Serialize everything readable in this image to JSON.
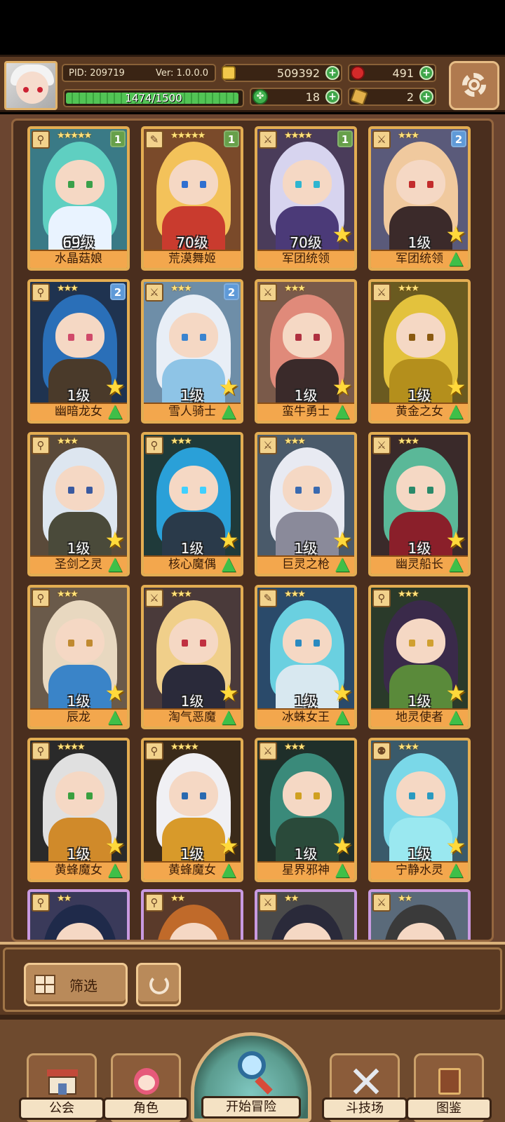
{
  "header": {
    "pid": "PID: 209719",
    "version": "Ver: 1.0.0.0",
    "gold": "509392",
    "gems": "491",
    "clover": "18",
    "keys": "2",
    "exp_text": "1474/1500",
    "exp_fraction": 0.983
  },
  "cards": [
    {
      "name": "水晶菇娘",
      "level": "69级",
      "stars": "★★★★★",
      "badge": "1",
      "badge_color": "green",
      "border": "gold",
      "hair": "#5fcfc1",
      "body": "#e9f3ff",
      "eye": "#3aa04a",
      "bg": "#3a7a86",
      "type_icon": "⚲",
      "show_upgrade": false
    },
    {
      "name": "荒漠舞姬",
      "level": "70级",
      "stars": "★★★★★",
      "badge": "1",
      "badge_color": "green",
      "border": "gold",
      "hair": "#f3c25a",
      "body": "#c93b2e",
      "eye": "#2f6fd0",
      "bg": "#7a4a2a",
      "type_icon": "✎",
      "show_upgrade": false
    },
    {
      "name": "军团统领",
      "level": "70级",
      "stars": "★★★★",
      "badge": "1",
      "badge_color": "green",
      "border": "gold",
      "hair": "#d7d4ef",
      "body": "#4b3a78",
      "eye": "#2fb5d0",
      "bg": "#4a3c5a",
      "type_icon": "⚔",
      "show_upgrade": false,
      "star_only": true
    },
    {
      "name": "军团统领",
      "level": "1级",
      "stars": "★★★",
      "badge": "2",
      "badge_color": "blue",
      "border": "gold",
      "hair": "#f0c99e",
      "body": "#3b2a2a",
      "eye": "#c32c2c",
      "bg": "#5a5a7a",
      "type_icon": "⚔",
      "show_upgrade": true
    },
    {
      "name": "幽暗龙女",
      "level": "1级",
      "stars": "★★★",
      "badge": "2",
      "badge_color": "blue",
      "border": "gold",
      "hair": "#2a6fb8",
      "body": "#4a3a2a",
      "eye": "#d04a6a",
      "bg": "#1f3350",
      "type_icon": "⚲",
      "show_upgrade": true
    },
    {
      "name": "雪人骑士",
      "level": "1级",
      "stars": "★★★",
      "badge": "2",
      "badge_color": "blue",
      "border": "gold",
      "hair": "#e8eef6",
      "body": "#8ec4e6",
      "eye": "#3a84d0",
      "bg": "#6e8ea8",
      "type_icon": "⚔",
      "show_upgrade": true
    },
    {
      "name": "蛮牛勇士",
      "level": "1级",
      "stars": "★★★",
      "badge": "",
      "badge_color": "",
      "border": "gold",
      "hair": "#e08a7a",
      "body": "#3a2a2a",
      "eye": "#b03040",
      "bg": "#7a5a4a",
      "type_icon": "⚔",
      "show_upgrade": true
    },
    {
      "name": "黄金之女",
      "level": "1级",
      "stars": "★★★",
      "badge": "",
      "badge_color": "",
      "border": "gold",
      "hair": "#e3c23d",
      "body": "#b48f1c",
      "eye": "#8a5a10",
      "bg": "#6a5a20",
      "type_icon": "⚔",
      "show_upgrade": true
    },
    {
      "name": "圣剑之灵",
      "level": "1级",
      "stars": "★★★",
      "badge": "",
      "badge_color": "",
      "border": "gold",
      "hair": "#dde6f0",
      "body": "#4a4a3a",
      "eye": "#3a5aa0",
      "bg": "#5a4a3a",
      "type_icon": "⚲",
      "show_upgrade": true
    },
    {
      "name": "核心魔偶",
      "level": "1级",
      "stars": "★★★",
      "badge": "",
      "badge_color": "",
      "border": "gold",
      "hair": "#2aa0d8",
      "body": "#2a3a4a",
      "eye": "#40d0ff",
      "bg": "#1f3a3a",
      "type_icon": "⚲",
      "show_upgrade": true
    },
    {
      "name": "巨灵之枪",
      "level": "1级",
      "stars": "★★★",
      "badge": "",
      "badge_color": "",
      "border": "gold",
      "hair": "#e8eaf2",
      "body": "#8a8a9a",
      "eye": "#3a6ab0",
      "bg": "#4a5a6a",
      "type_icon": "⚔",
      "show_upgrade": true
    },
    {
      "name": "幽灵船长",
      "level": "1级",
      "stars": "★★★",
      "badge": "",
      "badge_color": "",
      "border": "gold",
      "hair": "#5ab898",
      "body": "#8a1f2a",
      "eye": "#2a8a6a",
      "bg": "#3a2a2a",
      "type_icon": "⚔",
      "show_upgrade": true
    },
    {
      "name": "辰龙",
      "level": "1级",
      "stars": "★★★",
      "badge": "",
      "badge_color": "",
      "border": "gold",
      "hair": "#e8d8c0",
      "body": "#3a84c8",
      "eye": "#c08a30",
      "bg": "#6a5a4a",
      "type_icon": "⚲",
      "show_upgrade": true
    },
    {
      "name": "淘气恶魔",
      "level": "1级",
      "stars": "★★★",
      "badge": "",
      "badge_color": "",
      "border": "gold",
      "hair": "#f0cf8a",
      "body": "#2a2a3a",
      "eye": "#c03040",
      "bg": "#4a3a3a",
      "type_icon": "⚔",
      "show_upgrade": true
    },
    {
      "name": "冰蛛女王",
      "level": "1级",
      "stars": "★★★",
      "badge": "",
      "badge_color": "",
      "border": "gold",
      "hair": "#6ad0e0",
      "body": "#d8e8f0",
      "eye": "#2a8ac0",
      "bg": "#2a4a6a",
      "type_icon": "✎",
      "show_upgrade": true
    },
    {
      "name": "地灵使者",
      "level": "1级",
      "stars": "★★★",
      "badge": "",
      "badge_color": "",
      "border": "gold",
      "hair": "#3a2a4a",
      "body": "#5a8a3a",
      "eye": "#d0a030",
      "bg": "#2a3a2a",
      "type_icon": "⚲",
      "show_upgrade": true
    },
    {
      "name": "黄蜂魔女",
      "level": "1级",
      "stars": "★★★★",
      "badge": "",
      "badge_color": "",
      "border": "gold",
      "hair": "#e0e0e0",
      "body": "#d08a2a",
      "eye": "#3aa040",
      "bg": "#2a2a2a",
      "type_icon": "⚲",
      "show_upgrade": true
    },
    {
      "name": "黄蜂魔女",
      "level": "1级",
      "stars": "★★★★",
      "badge": "",
      "badge_color": "",
      "border": "gold",
      "hair": "#f0f0f4",
      "body": "#d89a2a",
      "eye": "#2a6ab0",
      "bg": "#3a2a1a",
      "type_icon": "⚲",
      "show_upgrade": true
    },
    {
      "name": "星界邪神",
      "level": "1级",
      "stars": "★★★",
      "badge": "",
      "badge_color": "",
      "border": "gold",
      "hair": "#3a8a7a",
      "body": "#2a4a3a",
      "eye": "#d0a020",
      "bg": "#1f2f2a",
      "type_icon": "⚔",
      "show_upgrade": true
    },
    {
      "name": "宁静水灵",
      "level": "1级",
      "stars": "★★★",
      "badge": "",
      "badge_color": "",
      "border": "gold",
      "hair": "#7ad8e8",
      "body": "#9ae8f0",
      "eye": "#2a9ac0",
      "bg": "#3a5a6a",
      "type_icon": "⚉",
      "show_upgrade": true
    },
    {
      "name": "",
      "level": "",
      "stars": "★★",
      "badge": "",
      "badge_color": "",
      "border": "purple",
      "hair": "#1f2a4a",
      "body": "#2a3a2a",
      "eye": "#40a040",
      "bg": "#3a3a5a",
      "type_icon": "⚲",
      "show_upgrade": false
    },
    {
      "name": "",
      "level": "",
      "stars": "★★",
      "badge": "",
      "badge_color": "",
      "border": "purple",
      "hair": "#c06a2a",
      "body": "#4a2a1a",
      "eye": "#c03030",
      "bg": "#5a3a2a",
      "type_icon": "⚲",
      "show_upgrade": false
    },
    {
      "name": "",
      "level": "",
      "stars": "★★",
      "badge": "",
      "badge_color": "",
      "border": "purple",
      "hair": "#2a2a3a",
      "body": "#e0e0e0",
      "eye": "#303030",
      "bg": "#4a4a4a",
      "type_icon": "⚔",
      "show_upgrade": false
    },
    {
      "name": "",
      "level": "",
      "stars": "★★",
      "badge": "",
      "badge_color": "",
      "border": "purple",
      "hair": "#3a3a3a",
      "body": "#e8e8e8",
      "eye": "#303030",
      "bg": "#5a6a7a",
      "type_icon": "⚔",
      "show_upgrade": false
    }
  ],
  "filter": {
    "label": "筛选"
  },
  "nav": {
    "guild": "公会",
    "character": "角色",
    "adventure": "开始冒险",
    "arena": "斗技场",
    "codex": "图鉴"
  }
}
